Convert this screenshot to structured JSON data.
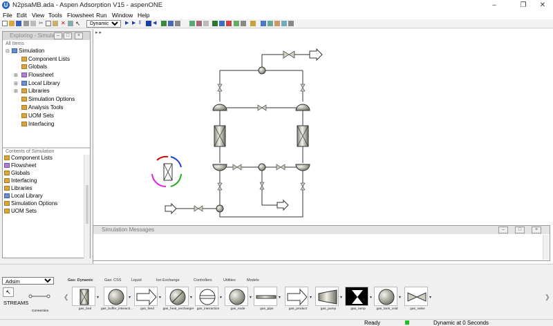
{
  "window": {
    "title": "N2psaMB.ada - Aspen Adsorption V15 - aspenONE",
    "app_icon_letter": "U",
    "minimize": "–",
    "restore": "❐",
    "close": "✕"
  },
  "menu": [
    "File",
    "Edit",
    "View",
    "Tools",
    "Flowsheet",
    "Run",
    "Window",
    "Help"
  ],
  "toolbar": {
    "run_mode_select": "Dynamic"
  },
  "explorer": {
    "title": "Exploring - Simulation",
    "all_items_label": "All Items",
    "tree": [
      "Simulation",
      "Component Lists",
      "Globals",
      "Flowsheet",
      "Local Library",
      "Libraries",
      "Simulation Options",
      "Analysis Tools",
      "UOM Sets",
      "Interfacing"
    ],
    "contents_label": "Contents of Simulation",
    "contents": [
      "Component Lists",
      "Flowsheet",
      "Globals",
      "Interfacing",
      "Libraries",
      "Local Library",
      "Simulation Options",
      "UOM Sets"
    ]
  },
  "canvas": {
    "tab_arrows": "▸ ▸"
  },
  "messages": {
    "title": "Simulation Messages"
  },
  "palette": {
    "library_select": "Adsim",
    "streams_label": "STREAMS",
    "connection_label": "Connection",
    "tabs": [
      "Gas: Dynamic",
      "Gas: CSS",
      "Liquid",
      "Ion Exchange",
      "Controllers",
      "Utilities",
      "Models"
    ],
    "items": [
      "gas_bed",
      "gas_buffer_interacti...",
      "gas_feed",
      "gas_heat_exchanger",
      "gas_interaction",
      "gas_node",
      "gas_pipe",
      "gas_product",
      "gas_pump",
      "gas_ramp",
      "gas_tank_void",
      "gas_valve"
    ]
  },
  "status": {
    "ready": "Ready",
    "run_state": "Dynamic at 0 Seconds"
  }
}
